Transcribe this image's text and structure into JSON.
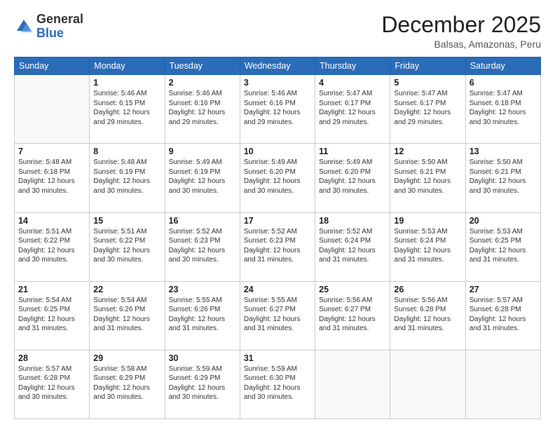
{
  "header": {
    "logo_general": "General",
    "logo_blue": "Blue",
    "month_title": "December 2025",
    "location": "Balsas, Amazonas, Peru"
  },
  "days_of_week": [
    "Sunday",
    "Monday",
    "Tuesday",
    "Wednesday",
    "Thursday",
    "Friday",
    "Saturday"
  ],
  "weeks": [
    [
      {
        "day": "",
        "info": ""
      },
      {
        "day": "1",
        "info": "Sunrise: 5:46 AM\nSunset: 6:15 PM\nDaylight: 12 hours\nand 29 minutes."
      },
      {
        "day": "2",
        "info": "Sunrise: 5:46 AM\nSunset: 6:16 PM\nDaylight: 12 hours\nand 29 minutes."
      },
      {
        "day": "3",
        "info": "Sunrise: 5:46 AM\nSunset: 6:16 PM\nDaylight: 12 hours\nand 29 minutes."
      },
      {
        "day": "4",
        "info": "Sunrise: 5:47 AM\nSunset: 6:17 PM\nDaylight: 12 hours\nand 29 minutes."
      },
      {
        "day": "5",
        "info": "Sunrise: 5:47 AM\nSunset: 6:17 PM\nDaylight: 12 hours\nand 29 minutes."
      },
      {
        "day": "6",
        "info": "Sunrise: 5:47 AM\nSunset: 6:18 PM\nDaylight: 12 hours\nand 30 minutes."
      }
    ],
    [
      {
        "day": "7",
        "info": "Sunrise: 5:48 AM\nSunset: 6:18 PM\nDaylight: 12 hours\nand 30 minutes."
      },
      {
        "day": "8",
        "info": "Sunrise: 5:48 AM\nSunset: 6:19 PM\nDaylight: 12 hours\nand 30 minutes."
      },
      {
        "day": "9",
        "info": "Sunrise: 5:49 AM\nSunset: 6:19 PM\nDaylight: 12 hours\nand 30 minutes."
      },
      {
        "day": "10",
        "info": "Sunrise: 5:49 AM\nSunset: 6:20 PM\nDaylight: 12 hours\nand 30 minutes."
      },
      {
        "day": "11",
        "info": "Sunrise: 5:49 AM\nSunset: 6:20 PM\nDaylight: 12 hours\nand 30 minutes."
      },
      {
        "day": "12",
        "info": "Sunrise: 5:50 AM\nSunset: 6:21 PM\nDaylight: 12 hours\nand 30 minutes."
      },
      {
        "day": "13",
        "info": "Sunrise: 5:50 AM\nSunset: 6:21 PM\nDaylight: 12 hours\nand 30 minutes."
      }
    ],
    [
      {
        "day": "14",
        "info": "Sunrise: 5:51 AM\nSunset: 6:22 PM\nDaylight: 12 hours\nand 30 minutes."
      },
      {
        "day": "15",
        "info": "Sunrise: 5:51 AM\nSunset: 6:22 PM\nDaylight: 12 hours\nand 30 minutes."
      },
      {
        "day": "16",
        "info": "Sunrise: 5:52 AM\nSunset: 6:23 PM\nDaylight: 12 hours\nand 30 minutes."
      },
      {
        "day": "17",
        "info": "Sunrise: 5:52 AM\nSunset: 6:23 PM\nDaylight: 12 hours\nand 31 minutes."
      },
      {
        "day": "18",
        "info": "Sunrise: 5:52 AM\nSunset: 6:24 PM\nDaylight: 12 hours\nand 31 minutes."
      },
      {
        "day": "19",
        "info": "Sunrise: 5:53 AM\nSunset: 6:24 PM\nDaylight: 12 hours\nand 31 minutes."
      },
      {
        "day": "20",
        "info": "Sunrise: 5:53 AM\nSunset: 6:25 PM\nDaylight: 12 hours\nand 31 minutes."
      }
    ],
    [
      {
        "day": "21",
        "info": "Sunrise: 5:54 AM\nSunset: 6:25 PM\nDaylight: 12 hours\nand 31 minutes."
      },
      {
        "day": "22",
        "info": "Sunrise: 5:54 AM\nSunset: 6:26 PM\nDaylight: 12 hours\nand 31 minutes."
      },
      {
        "day": "23",
        "info": "Sunrise: 5:55 AM\nSunset: 6:26 PM\nDaylight: 12 hours\nand 31 minutes."
      },
      {
        "day": "24",
        "info": "Sunrise: 5:55 AM\nSunset: 6:27 PM\nDaylight: 12 hours\nand 31 minutes."
      },
      {
        "day": "25",
        "info": "Sunrise: 5:56 AM\nSunset: 6:27 PM\nDaylight: 12 hours\nand 31 minutes."
      },
      {
        "day": "26",
        "info": "Sunrise: 5:56 AM\nSunset: 6:28 PM\nDaylight: 12 hours\nand 31 minutes."
      },
      {
        "day": "27",
        "info": "Sunrise: 5:57 AM\nSunset: 6:28 PM\nDaylight: 12 hours\nand 31 minutes."
      }
    ],
    [
      {
        "day": "28",
        "info": "Sunrise: 5:57 AM\nSunset: 6:28 PM\nDaylight: 12 hours\nand 30 minutes."
      },
      {
        "day": "29",
        "info": "Sunrise: 5:58 AM\nSunset: 6:29 PM\nDaylight: 12 hours\nand 30 minutes."
      },
      {
        "day": "30",
        "info": "Sunrise: 5:59 AM\nSunset: 6:29 PM\nDaylight: 12 hours\nand 30 minutes."
      },
      {
        "day": "31",
        "info": "Sunrise: 5:59 AM\nSunset: 6:30 PM\nDaylight: 12 hours\nand 30 minutes."
      },
      {
        "day": "",
        "info": ""
      },
      {
        "day": "",
        "info": ""
      },
      {
        "day": "",
        "info": ""
      }
    ]
  ]
}
